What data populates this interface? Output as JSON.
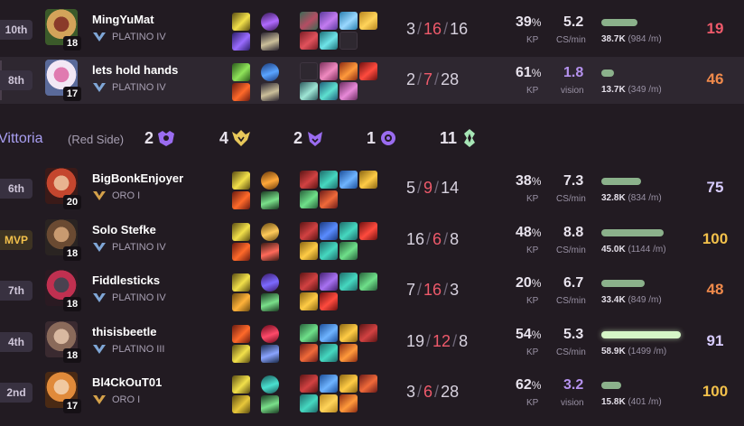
{
  "colors": {
    "death": "#ef5a6b",
    "team_name": "#a99ff2",
    "vision_value": "#b592ee",
    "mvp": "#f3c14b"
  },
  "players": [
    {
      "place": "10th",
      "place_class": "",
      "name": "MingYuMat",
      "rank": "PLATINO IV",
      "rank_tier": "platinum",
      "level": "18",
      "portrait": "yordle-green-helmet",
      "spells": [
        "flash-spell",
        "teleport-spell"
      ],
      "runes": [
        "dark-harvest-rune",
        "domination-shard"
      ],
      "items": [
        "item-mask",
        "item-violet-blade",
        "item-blue-staff",
        "item-gold-orb",
        "item-crimson-relic",
        "item-cyan-blade",
        "empty"
      ],
      "kills": "3",
      "deaths": "16",
      "assists": "16",
      "kp": "39",
      "pct": "%",
      "kp_label": "KP",
      "stat2": "5.2",
      "stat2_label": "CS/min",
      "stat2_class": "",
      "dmg": "38.7K",
      "dmg_rate": "(984 /m)",
      "dmg_fraction": 0.45,
      "score": "19",
      "score_color": "#ef5a6b",
      "highlight": false
    },
    {
      "place": "8th",
      "place_class": "",
      "name": "lets hold hands",
      "rank": "PLATINO IV",
      "rank_tier": "platinum",
      "level": "17",
      "portrait": "fluffy-white-yordle",
      "spells": [
        "heal-spell",
        "ignite-spell"
      ],
      "runes": [
        "glacial-rune",
        "domination-shard"
      ],
      "items": [
        "empty",
        "item-pink-charm",
        "item-fire-tome",
        "item-red-orb",
        "item-moon-stone",
        "item-cyan-tome",
        "item-pink-lantern"
      ],
      "kills": "2",
      "deaths": "7",
      "assists": "28",
      "kp": "61",
      "pct": "%",
      "kp_label": "KP",
      "stat2": "1.8",
      "stat2_label": "vision",
      "stat2_class": "vis",
      "dmg": "13.7K",
      "dmg_rate": "(349 /m)",
      "dmg_fraction": 0.16,
      "score": "46",
      "score_color": "#f08a4b",
      "highlight": true
    }
  ],
  "team": {
    "name": "Vittoria",
    "side": "(Red Side)",
    "objectives": [
      {
        "count": "2",
        "icon": "baron-icon",
        "color": "#9a6cf0"
      },
      {
        "count": "4",
        "icon": "dragon-icon",
        "color": "#e8c85a"
      },
      {
        "count": "2",
        "icon": "herald-icon",
        "color": "#9a6cf0"
      },
      {
        "count": "1",
        "icon": "grub-icon",
        "color": "#9a6cf0"
      },
      {
        "count": "11",
        "icon": "tower-icon",
        "color": "#a7e6b6"
      }
    ]
  },
  "players2": [
    {
      "place": "6th",
      "place_class": "",
      "name": "BigBonkEnjoyer",
      "rank": "ORO I",
      "rank_tier": "gold",
      "level": "20",
      "portrait": "red-hair-fighter",
      "spells": [
        "flash-spell",
        "ignite-spell"
      ],
      "runes": [
        "conqueror-rune",
        "resolve-shard"
      ],
      "items": [
        "item-bloody-axe",
        "item-teal-crest",
        "item-blue-crown",
        "item-gold-gear",
        "item-green-blade",
        "item-red-claw"
      ],
      "kills": "5",
      "deaths": "9",
      "assists": "14",
      "kp": "38",
      "pct": "%",
      "kp_label": "KP",
      "stat2": "7.3",
      "stat2_label": "CS/min",
      "stat2_class": "",
      "dmg": "32.8K",
      "dmg_rate": "(834 /m)",
      "dmg_fraction": 0.5,
      "score": "75",
      "score_color": "#d8ccff",
      "highlight": false
    },
    {
      "place": "MVP",
      "place_class": "mvp",
      "name": "Solo Stefke",
      "rank": "PLATINO IV",
      "rank_tier": "platinum",
      "level": "18",
      "portrait": "bearded-warrior",
      "spells": [
        "flash-spell",
        "ignite-spell"
      ],
      "runes": [
        "lethal-tempo-rune",
        "precision-shard"
      ],
      "items": [
        "item-bloody-axe",
        "item-sapphire",
        "item-teal-crest",
        "item-red-orb",
        "item-gold-gear",
        "item-teal-crest",
        "item-green-blade"
      ],
      "kills": "16",
      "deaths": "6",
      "assists": "8",
      "kp": "48",
      "pct": "%",
      "kp_label": "KP",
      "stat2": "8.8",
      "stat2_label": "CS/min",
      "stat2_class": "",
      "dmg": "45.0K",
      "dmg_rate": "(1144 /m)",
      "dmg_fraction": 0.78,
      "score": "100",
      "score_color": "#f3c14b",
      "highlight": false
    },
    {
      "place": "7th",
      "place_class": "",
      "name": "Fiddlesticks",
      "rank": "PLATINO IV",
      "rank_tier": "platinum",
      "level": "18",
      "portrait": "dark-scarecrow",
      "spells": [
        "flash-spell",
        "smite-spell"
      ],
      "runes": [
        "arcane-comet-rune",
        "resolve-shard"
      ],
      "items": [
        "item-bloody-axe",
        "item-purple-staff",
        "item-teal-crest",
        "item-green-blade",
        "item-gold-gear",
        "item-red-orb"
      ],
      "kills": "7",
      "deaths": "16",
      "assists": "3",
      "kp": "20",
      "pct": "%",
      "kp_label": "KP",
      "stat2": "6.7",
      "stat2_label": "CS/min",
      "stat2_class": "",
      "dmg": "33.4K",
      "dmg_rate": "(849 /m)",
      "dmg_fraction": 0.55,
      "score": "48",
      "score_color": "#f08a4b",
      "highlight": false
    },
    {
      "place": "4th",
      "place_class": "",
      "name": "thisisbeetle",
      "rank": "PLATINO III",
      "rank_tier": "platinum",
      "level": "18",
      "portrait": "horned-lancer",
      "spells": [
        "ignite-spell",
        "flash-spell"
      ],
      "runes": [
        "electrocute-rune",
        "inspiration-shard"
      ],
      "items": [
        "item-green-blade",
        "item-blue-crown",
        "item-gold-gear",
        "item-bloody-axe",
        "item-red-claw",
        "item-teal-crest",
        "item-fire-tome"
      ],
      "kills": "19",
      "deaths": "12",
      "assists": "8",
      "kp": "54",
      "pct": "%",
      "kp_label": "KP",
      "stat2": "5.3",
      "stat2_label": "CS/min",
      "stat2_class": "",
      "dmg": "58.9K",
      "dmg_rate": "(1499 /m)",
      "dmg_fraction": 1.0,
      "score": "91",
      "score_color": "#d8ccff",
      "highlight": false
    },
    {
      "place": "2nd",
      "place_class": "",
      "name": "Bl4CkOuT01",
      "rank": "ORO I",
      "rank_tier": "gold",
      "level": "17",
      "portrait": "orange-hair-support",
      "spells": [
        "flash-spell",
        "exhaust-spell"
      ],
      "runes": [
        "guardian-rune",
        "resolve-shard"
      ],
      "items": [
        "item-bloody-axe",
        "item-blue-crown",
        "item-gold-gear",
        "item-red-claw",
        "item-teal-crest",
        "item-gold-orb",
        "item-fire-tome"
      ],
      "kills": "3",
      "deaths": "6",
      "assists": "28",
      "kp": "62",
      "pct": "%",
      "kp_label": "KP",
      "stat2": "3.2",
      "stat2_label": "vision",
      "stat2_class": "vis",
      "dmg": "15.8K",
      "dmg_rate": "(401 /m)",
      "dmg_fraction": 0.25,
      "score": "100",
      "score_color": "#f3c14b",
      "highlight": false
    }
  ]
}
